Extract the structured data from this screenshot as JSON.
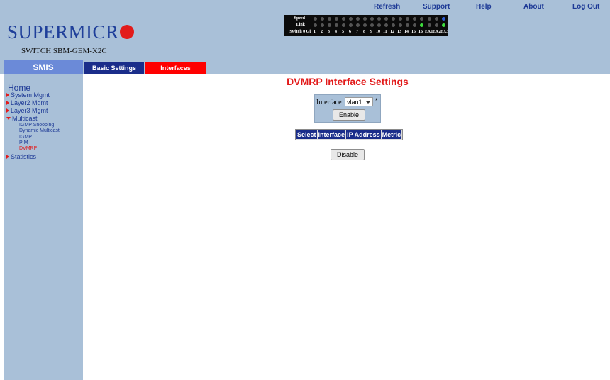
{
  "header": {
    "logo_text": "SUPERMICR",
    "switch_name": "SWITCH SBM-GEM-X2C",
    "links": [
      "Refresh",
      "Support",
      "Help",
      "About",
      "Log Out"
    ]
  },
  "ports": {
    "speed_label": "Speed",
    "link_label": "Link",
    "switch_label": "Switch 0 Gi",
    "numbers": [
      "1",
      "2",
      "3",
      "4",
      "5",
      "6",
      "7",
      "8",
      "9",
      "10",
      "11",
      "12",
      "13",
      "14",
      "15",
      "16",
      "EX1",
      "EX2",
      "EX3"
    ]
  },
  "nav": {
    "smis": "SMIS",
    "tabs": [
      "Basic Settings",
      "Interfaces"
    ]
  },
  "sidebar": {
    "home": "Home",
    "items": [
      "System Mgmt",
      "Layer2 Mgmt",
      "Layer3 Mgmt",
      "Multicast",
      "Statistics"
    ],
    "multicast_sub": [
      "IGMP Snooping",
      "Dynamic Multicast",
      "IGMP",
      "PIM",
      "DVMRP"
    ]
  },
  "main": {
    "title": "DVMRP Interface Settings",
    "interface_label": "Interface",
    "interface_value": "vlan1",
    "required_mark": "*",
    "enable_button": "Enable",
    "table_headers": [
      "Select",
      "Interface",
      "IP Address",
      "Metric"
    ],
    "disable_button": "Disable"
  },
  "colors": {
    "header_bg": "#a9c0d8",
    "accent_red": "#e21b1b",
    "tab_blue": "#1a2d8a",
    "tab_red": "#ff0000",
    "link_blue": "#1e3a96"
  }
}
